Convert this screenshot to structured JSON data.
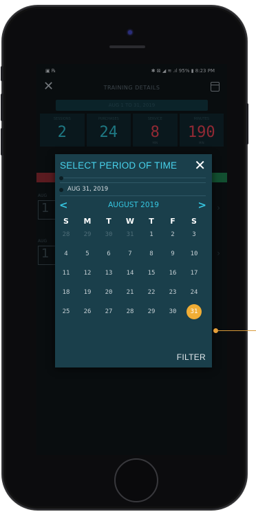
{
  "status_bar": {
    "left_icons": "▣ ℞",
    "right": "✱ ⊠ ◢ ≋ .ıl 95% ▮ 8:23 PM"
  },
  "app_bar": {
    "title": "TRAINING DETAILS",
    "subtitle": "AUG 1 TO 31, 2019"
  },
  "stats": [
    {
      "label": "SESSIONS",
      "value": "2",
      "sub": "",
      "color": "#2fb8c9"
    },
    {
      "label": "PURCHASES",
      "value": "24",
      "sub": "",
      "color": "#2fb8c9"
    },
    {
      "label": "SERVICE",
      "value": "8",
      "sub": "MIN",
      "color": "#e04050"
    },
    {
      "label": "MINUTES",
      "value": "190",
      "sub": "MIN",
      "color": "#e04050"
    }
  ],
  "background_rows": [
    {
      "label": "AUG",
      "value": "1"
    },
    {
      "label": "AUG",
      "value": "1"
    }
  ],
  "dialog": {
    "title": "SELECT PERIOD OF TIME",
    "close_label": "✕",
    "range_from": "",
    "range_to": "AUG 31, 2019",
    "month_label": "AUGUST 2019",
    "prev_label": "<",
    "next_label": ">",
    "weekdays": [
      "S",
      "M",
      "T",
      "W",
      "T",
      "F",
      "S"
    ],
    "weeks": [
      [
        {
          "d": "28",
          "muted": true
        },
        {
          "d": "29",
          "muted": true
        },
        {
          "d": "30",
          "muted": true
        },
        {
          "d": "31",
          "muted": true
        },
        {
          "d": "1"
        },
        {
          "d": "2"
        },
        {
          "d": "3"
        }
      ],
      [
        {
          "d": "4"
        },
        {
          "d": "5"
        },
        {
          "d": "6"
        },
        {
          "d": "7"
        },
        {
          "d": "8"
        },
        {
          "d": "9"
        },
        {
          "d": "10"
        }
      ],
      [
        {
          "d": "11"
        },
        {
          "d": "12"
        },
        {
          "d": "13"
        },
        {
          "d": "14"
        },
        {
          "d": "15"
        },
        {
          "d": "16"
        },
        {
          "d": "17"
        }
      ],
      [
        {
          "d": "18"
        },
        {
          "d": "19"
        },
        {
          "d": "20"
        },
        {
          "d": "21"
        },
        {
          "d": "22"
        },
        {
          "d": "23"
        },
        {
          "d": "24"
        }
      ],
      [
        {
          "d": "25"
        },
        {
          "d": "26"
        },
        {
          "d": "27"
        },
        {
          "d": "28"
        },
        {
          "d": "29"
        },
        {
          "d": "30"
        },
        {
          "d": "31",
          "selected": true
        }
      ]
    ],
    "filter_label": "FILTER"
  },
  "colors": {
    "accent": "#36c7e2",
    "selected_day": "#f0ad35",
    "dialog_bg": "#1a3f4b"
  }
}
